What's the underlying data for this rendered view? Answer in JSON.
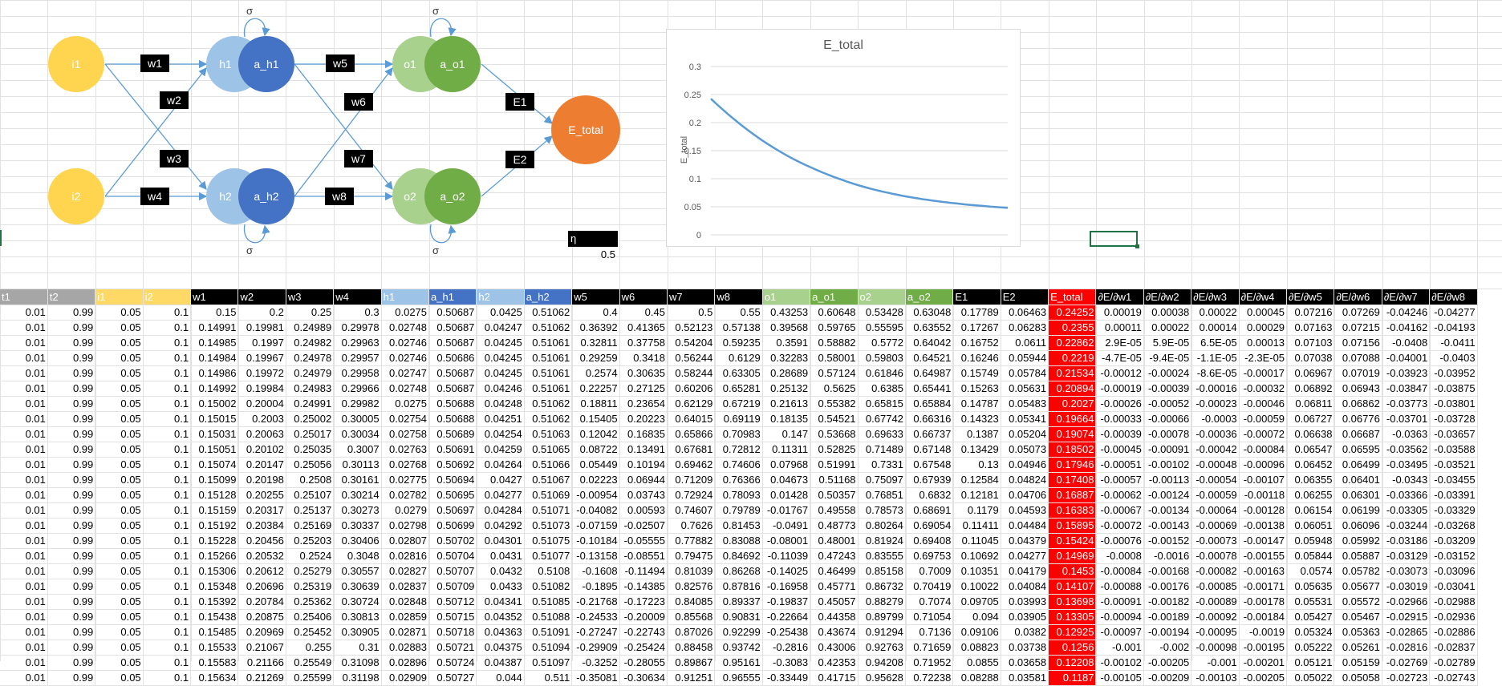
{
  "diagram": {
    "inputs": [
      "i1",
      "i2"
    ],
    "hidden_net": [
      "h1",
      "h2"
    ],
    "hidden_act": [
      "a_h1",
      "a_h2"
    ],
    "output_net": [
      "o1",
      "o2"
    ],
    "output_act": [
      "a_o1",
      "a_o2"
    ],
    "total": "E_total",
    "weights": [
      "w1",
      "w2",
      "w3",
      "w4",
      "w5",
      "w6",
      "w7",
      "w8"
    ],
    "errors": [
      "E1",
      "E2"
    ],
    "sigma": "σ"
  },
  "eta": {
    "label": "η",
    "value": "0.5"
  },
  "chart_data": {
    "type": "line",
    "title": "E_total",
    "ylabel": "E_total",
    "xlabel": "",
    "ylim": [
      0,
      0.3
    ],
    "yticks": [
      "0",
      "0.05",
      "0.1",
      "0.15",
      "0.2",
      "0.25",
      "0.3"
    ],
    "series": [
      {
        "values": [
          0.24252,
          0.2355,
          0.22862,
          0.2219,
          0.21534,
          0.20894,
          0.2027,
          0.19664,
          0.19074,
          0.18502,
          0.17946,
          0.17408,
          0.16887,
          0.16383,
          0.15895,
          0.15424,
          0.14969,
          0.1453,
          0.14107,
          0.13698,
          0.13305,
          0.12925,
          0.1256,
          0.12208,
          0.1187,
          0.1154,
          0.1122,
          0.1091,
          0.1061,
          0.1032,
          0.1004,
          0.0977,
          0.0951,
          0.0926,
          0.0902,
          0.0879,
          0.0857,
          0.0836,
          0.0816,
          0.0797,
          0.0779,
          0.0762,
          0.0745,
          0.0729,
          0.0714,
          0.0699,
          0.0685,
          0.0672,
          0.0659,
          0.0647,
          0.0635,
          0.0624,
          0.0613,
          0.0603,
          0.0593,
          0.0584,
          0.0575,
          0.0566,
          0.0558,
          0.055,
          0.0542,
          0.0535,
          0.0528,
          0.0521,
          0.0515,
          0.0508,
          0.0502,
          0.0497,
          0.0491,
          0.0486,
          0.048
        ]
      }
    ]
  },
  "table": {
    "headers": [
      "t1",
      "t2",
      "i1",
      "i2",
      "w1",
      "w2",
      "w3",
      "w4",
      "h1",
      "a_h1",
      "h2",
      "a_h2",
      "w5",
      "w6",
      "w7",
      "w8",
      "o1",
      "a_o1",
      "o2",
      "a_o2",
      "E1",
      "E2",
      "E_total",
      "∂E/∂w1",
      "∂E/∂w2",
      "∂E/∂w3",
      "∂E/∂w4",
      "∂E/∂w5",
      "∂E/∂w6",
      "∂E/∂w7",
      "∂E/∂w8"
    ],
    "header_colors": [
      "#a6a6a6",
      "#a6a6a6",
      "#ffd966",
      "#ffd966",
      "#000000",
      "#000000",
      "#000000",
      "#000000",
      "#9dc3e6",
      "#4472c4",
      "#9dc3e6",
      "#4472c4",
      "#000000",
      "#000000",
      "#000000",
      "#000000",
      "#a9d18e",
      "#70ad47",
      "#a9d18e",
      "#70ad47",
      "#000000",
      "#000000",
      "#ff0000",
      "#000000",
      "#000000",
      "#000000",
      "#000000",
      "#000000",
      "#000000",
      "#000000",
      "#000000"
    ],
    "rows": [
      [
        "0.01",
        "0.99",
        "0.05",
        "0.1",
        "0.15",
        "0.2",
        "0.25",
        "0.3",
        "0.0275",
        "0.50687",
        "0.0425",
        "0.51062",
        "0.4",
        "0.45",
        "0.5",
        "0.55",
        "0.43253",
        "0.60648",
        "0.53428",
        "0.63048",
        "0.17789",
        "0.06463",
        "0.24252",
        "0.00019",
        "0.00038",
        "0.00022",
        "0.00045",
        "0.07216",
        "0.07269",
        "-0.04246",
        "-0.04277"
      ],
      [
        "0.01",
        "0.99",
        "0.05",
        "0.1",
        "0.14991",
        "0.19981",
        "0.24989",
        "0.29978",
        "0.02748",
        "0.50687",
        "0.04247",
        "0.51062",
        "0.36392",
        "0.41365",
        "0.52123",
        "0.57138",
        "0.39568",
        "0.59765",
        "0.55595",
        "0.63552",
        "0.17267",
        "0.06283",
        "0.2355",
        "0.00011",
        "0.00022",
        "0.00014",
        "0.00029",
        "0.07163",
        "0.07215",
        "-0.04162",
        "-0.04193"
      ],
      [
        "0.01",
        "0.99",
        "0.05",
        "0.1",
        "0.14985",
        "0.1997",
        "0.24982",
        "0.29963",
        "0.02746",
        "0.50687",
        "0.04245",
        "0.51061",
        "0.32811",
        "0.37758",
        "0.54204",
        "0.59235",
        "0.3591",
        "0.58882",
        "0.5772",
        "0.64042",
        "0.16752",
        "0.0611",
        "0.22862",
        "2.9E-05",
        "5.9E-05",
        "6.5E-05",
        "0.00013",
        "0.07103",
        "0.07156",
        "-0.0408",
        "-0.0411"
      ],
      [
        "0.01",
        "0.99",
        "0.05",
        "0.1",
        "0.14984",
        "0.19967",
        "0.24978",
        "0.29957",
        "0.02746",
        "0.50686",
        "0.04245",
        "0.51061",
        "0.29259",
        "0.3418",
        "0.56244",
        "0.6129",
        "0.32283",
        "0.58001",
        "0.59803",
        "0.64521",
        "0.16246",
        "0.05944",
        "0.2219",
        "-4.7E-05",
        "-9.4E-05",
        "-1.1E-05",
        "-2.3E-05",
        "0.07038",
        "0.07088",
        "-0.04001",
        "-0.0403"
      ],
      [
        "0.01",
        "0.99",
        "0.05",
        "0.1",
        "0.14986",
        "0.19972",
        "0.24979",
        "0.29958",
        "0.02747",
        "0.50687",
        "0.04245",
        "0.51061",
        "0.2574",
        "0.30635",
        "0.58244",
        "0.63305",
        "0.28689",
        "0.57124",
        "0.61846",
        "0.64987",
        "0.15749",
        "0.05784",
        "0.21534",
        "-0.00012",
        "-0.00024",
        "-8.6E-05",
        "-0.00017",
        "0.06967",
        "0.07019",
        "-0.03923",
        "-0.03952"
      ],
      [
        "0.01",
        "0.99",
        "0.05",
        "0.1",
        "0.14992",
        "0.19984",
        "0.24983",
        "0.29966",
        "0.02748",
        "0.50687",
        "0.04246",
        "0.51061",
        "0.22257",
        "0.27125",
        "0.60206",
        "0.65281",
        "0.25132",
        "0.5625",
        "0.6385",
        "0.65441",
        "0.15263",
        "0.05631",
        "0.20894",
        "-0.00019",
        "-0.00039",
        "-0.00016",
        "-0.00032",
        "0.06892",
        "0.06943",
        "-0.03847",
        "-0.03875"
      ],
      [
        "0.01",
        "0.99",
        "0.05",
        "0.1",
        "0.15002",
        "0.20004",
        "0.24991",
        "0.29982",
        "0.0275",
        "0.50688",
        "0.04248",
        "0.51062",
        "0.18811",
        "0.23654",
        "0.62129",
        "0.67219",
        "0.21613",
        "0.55382",
        "0.65815",
        "0.65884",
        "0.14787",
        "0.05483",
        "0.2027",
        "-0.00026",
        "-0.00052",
        "-0.00023",
        "-0.00046",
        "0.06811",
        "0.06862",
        "-0.03773",
        "-0.03801"
      ],
      [
        "0.01",
        "0.99",
        "0.05",
        "0.1",
        "0.15015",
        "0.2003",
        "0.25002",
        "0.30005",
        "0.02754",
        "0.50688",
        "0.04251",
        "0.51062",
        "0.15405",
        "0.20223",
        "0.64015",
        "0.69119",
        "0.18135",
        "0.54521",
        "0.67742",
        "0.66316",
        "0.14323",
        "0.05341",
        "0.19664",
        "-0.00033",
        "-0.00066",
        "-0.0003",
        "-0.00059",
        "0.06727",
        "0.06776",
        "-0.03701",
        "-0.03728"
      ],
      [
        "0.01",
        "0.99",
        "0.05",
        "0.1",
        "0.15031",
        "0.20063",
        "0.25017",
        "0.30034",
        "0.02758",
        "0.50689",
        "0.04254",
        "0.51063",
        "0.12042",
        "0.16835",
        "0.65866",
        "0.70983",
        "0.147",
        "0.53668",
        "0.69633",
        "0.66737",
        "0.1387",
        "0.05204",
        "0.19074",
        "-0.00039",
        "-0.00078",
        "-0.00036",
        "-0.00072",
        "0.06638",
        "0.06687",
        "-0.0363",
        "-0.03657"
      ],
      [
        "0.01",
        "0.99",
        "0.05",
        "0.1",
        "0.15051",
        "0.20102",
        "0.25035",
        "0.3007",
        "0.02763",
        "0.50691",
        "0.04259",
        "0.51065",
        "0.08722",
        "0.13491",
        "0.67681",
        "0.72812",
        "0.11311",
        "0.52825",
        "0.71489",
        "0.67148",
        "0.13429",
        "0.05073",
        "0.18502",
        "-0.00045",
        "-0.00091",
        "-0.00042",
        "-0.00084",
        "0.06547",
        "0.06595",
        "-0.03562",
        "-0.03588"
      ],
      [
        "0.01",
        "0.99",
        "0.05",
        "0.1",
        "0.15074",
        "0.20147",
        "0.25056",
        "0.30113",
        "0.02768",
        "0.50692",
        "0.04264",
        "0.51066",
        "0.05449",
        "0.10194",
        "0.69462",
        "0.74606",
        "0.07968",
        "0.51991",
        "0.7331",
        "0.67548",
        "0.13",
        "0.04946",
        "0.17946",
        "-0.00051",
        "-0.00102",
        "-0.00048",
        "-0.00096",
        "0.06452",
        "0.06499",
        "-0.03495",
        "-0.03521"
      ],
      [
        "0.01",
        "0.99",
        "0.05",
        "0.1",
        "0.15099",
        "0.20198",
        "0.2508",
        "0.30161",
        "0.02775",
        "0.50694",
        "0.0427",
        "0.51067",
        "0.02223",
        "0.06944",
        "0.71209",
        "0.76366",
        "0.04673",
        "0.51168",
        "0.75097",
        "0.67939",
        "0.12584",
        "0.04824",
        "0.17408",
        "-0.00057",
        "-0.00113",
        "-0.00054",
        "-0.00107",
        "0.06355",
        "0.06401",
        "-0.0343",
        "-0.03455"
      ],
      [
        "0.01",
        "0.99",
        "0.05",
        "0.1",
        "0.15128",
        "0.20255",
        "0.25107",
        "0.30214",
        "0.02782",
        "0.50695",
        "0.04277",
        "0.51069",
        "-0.00954",
        "0.03743",
        "0.72924",
        "0.78093",
        "0.01428",
        "0.50357",
        "0.76851",
        "0.6832",
        "0.12181",
        "0.04706",
        "0.16887",
        "-0.00062",
        "-0.00124",
        "-0.00059",
        "-0.00118",
        "0.06255",
        "0.06301",
        "-0.03366",
        "-0.03391"
      ],
      [
        "0.01",
        "0.99",
        "0.05",
        "0.1",
        "0.15159",
        "0.20317",
        "0.25137",
        "0.30273",
        "0.0279",
        "0.50697",
        "0.04284",
        "0.51071",
        "-0.04082",
        "0.00593",
        "0.74607",
        "0.79789",
        "-0.01767",
        "0.49558",
        "0.78573",
        "0.68691",
        "0.1179",
        "0.04593",
        "0.16383",
        "-0.00067",
        "-0.00134",
        "-0.00064",
        "-0.00128",
        "0.06154",
        "0.06199",
        "-0.03305",
        "-0.03329"
      ],
      [
        "0.01",
        "0.99",
        "0.05",
        "0.1",
        "0.15192",
        "0.20384",
        "0.25169",
        "0.30337",
        "0.02798",
        "0.50699",
        "0.04292",
        "0.51073",
        "-0.07159",
        "-0.02507",
        "0.7626",
        "0.81453",
        "-0.0491",
        "0.48773",
        "0.80264",
        "0.69054",
        "0.11411",
        "0.04484",
        "0.15895",
        "-0.00072",
        "-0.00143",
        "-0.00069",
        "-0.00138",
        "0.06051",
        "0.06096",
        "-0.03244",
        "-0.03268"
      ],
      [
        "0.01",
        "0.99",
        "0.05",
        "0.1",
        "0.15228",
        "0.20456",
        "0.25203",
        "0.30406",
        "0.02807",
        "0.50702",
        "0.04301",
        "0.51075",
        "-0.10184",
        "-0.05555",
        "0.77882",
        "0.83088",
        "-0.08001",
        "0.48001",
        "0.81924",
        "0.69408",
        "0.11045",
        "0.04379",
        "0.15424",
        "-0.00076",
        "-0.00152",
        "-0.00073",
        "-0.00147",
        "0.05948",
        "0.05992",
        "-0.03186",
        "-0.03209"
      ],
      [
        "0.01",
        "0.99",
        "0.05",
        "0.1",
        "0.15266",
        "0.20532",
        "0.2524",
        "0.3048",
        "0.02816",
        "0.50704",
        "0.0431",
        "0.51077",
        "-0.13158",
        "-0.08551",
        "0.79475",
        "0.84692",
        "-0.11039",
        "0.47243",
        "0.83555",
        "0.69753",
        "0.10692",
        "0.04277",
        "0.14969",
        "-0.0008",
        "-0.0016",
        "-0.00078",
        "-0.00155",
        "0.05844",
        "0.05887",
        "-0.03129",
        "-0.03152"
      ],
      [
        "0.01",
        "0.99",
        "0.05",
        "0.1",
        "0.15306",
        "0.20612",
        "0.25279",
        "0.30557",
        "0.02827",
        "0.50707",
        "0.0432",
        "0.5108",
        "-0.1608",
        "-0.11494",
        "0.81039",
        "0.86268",
        "-0.14025",
        "0.46499",
        "0.85158",
        "0.7009",
        "0.10351",
        "0.04179",
        "0.1453",
        "-0.00084",
        "-0.00168",
        "-0.00082",
        "-0.00163",
        "0.0574",
        "0.05782",
        "-0.03073",
        "-0.03096"
      ],
      [
        "0.01",
        "0.99",
        "0.05",
        "0.1",
        "0.15348",
        "0.20696",
        "0.25319",
        "0.30639",
        "0.02837",
        "0.50709",
        "0.0433",
        "0.51082",
        "-0.1895",
        "-0.14385",
        "0.82576",
        "0.87816",
        "-0.16958",
        "0.45771",
        "0.86732",
        "0.70419",
        "0.10022",
        "0.04084",
        "0.14107",
        "-0.00088",
        "-0.00176",
        "-0.00085",
        "-0.00171",
        "0.05635",
        "0.05677",
        "-0.03019",
        "-0.03041"
      ],
      [
        "0.01",
        "0.99",
        "0.05",
        "0.1",
        "0.15392",
        "0.20784",
        "0.25362",
        "0.30724",
        "0.02848",
        "0.50712",
        "0.04341",
        "0.51085",
        "-0.21768",
        "-0.17223",
        "0.84085",
        "0.89337",
        "-0.19837",
        "0.45057",
        "0.88279",
        "0.7074",
        "0.09705",
        "0.03993",
        "0.13698",
        "-0.00091",
        "-0.00182",
        "-0.00089",
        "-0.00178",
        "0.05531",
        "0.05572",
        "-0.02966",
        "-0.02988"
      ],
      [
        "0.01",
        "0.99",
        "0.05",
        "0.1",
        "0.15438",
        "0.20875",
        "0.25406",
        "0.30813",
        "0.02859",
        "0.50715",
        "0.04352",
        "0.51088",
        "-0.24533",
        "-0.20009",
        "0.85568",
        "0.90831",
        "-0.22664",
        "0.44358",
        "0.89799",
        "0.71054",
        "0.094",
        "0.03905",
        "0.13305",
        "-0.00094",
        "-0.00189",
        "-0.00092",
        "-0.00184",
        "0.05427",
        "0.05467",
        "-0.02915",
        "-0.02936"
      ],
      [
        "0.01",
        "0.99",
        "0.05",
        "0.1",
        "0.15485",
        "0.20969",
        "0.25452",
        "0.30905",
        "0.02871",
        "0.50718",
        "0.04363",
        "0.51091",
        "-0.27247",
        "-0.22743",
        "0.87026",
        "0.92299",
        "-0.25438",
        "0.43674",
        "0.91294",
        "0.7136",
        "0.09106",
        "0.0382",
        "0.12925",
        "-0.00097",
        "-0.00194",
        "-0.00095",
        "-0.0019",
        "0.05324",
        "0.05363",
        "-0.02865",
        "-0.02886"
      ],
      [
        "0.01",
        "0.99",
        "0.05",
        "0.1",
        "0.15533",
        "0.21067",
        "0.255",
        "0.31",
        "0.02883",
        "0.50721",
        "0.04375",
        "0.51094",
        "-0.29909",
        "-0.25424",
        "0.88458",
        "0.93742",
        "-0.2816",
        "0.43006",
        "0.92763",
        "0.71659",
        "0.08823",
        "0.03738",
        "0.1256",
        "-0.001",
        "-0.002",
        "-0.00098",
        "-0.00195",
        "0.05222",
        "0.05261",
        "-0.02816",
        "-0.02837"
      ],
      [
        "0.01",
        "0.99",
        "0.05",
        "0.1",
        "0.15583",
        "0.21166",
        "0.25549",
        "0.31098",
        "0.02896",
        "0.50724",
        "0.04387",
        "0.51097",
        "-0.3252",
        "-0.28055",
        "0.89867",
        "0.95161",
        "-0.3083",
        "0.42353",
        "0.94208",
        "0.71952",
        "0.0855",
        "0.03658",
        "0.12208",
        "-0.00102",
        "-0.00205",
        "-0.001",
        "-0.00201",
        "0.05121",
        "0.05159",
        "-0.02769",
        "-0.02789"
      ],
      [
        "0.01",
        "0.99",
        "0.05",
        "0.1",
        "0.15634",
        "0.21269",
        "0.25599",
        "0.31198",
        "0.02909",
        "0.50727",
        "0.044",
        "0.511",
        "-0.35081",
        "-0.30634",
        "0.91251",
        "0.96555",
        "-0.33449",
        "0.41715",
        "0.95628",
        "0.72238",
        "0.08288",
        "0.03581",
        "0.1187",
        "-0.00105",
        "-0.00209",
        "-0.00103",
        "-0.00205",
        "0.05022",
        "0.05058",
        "-0.02723",
        "-0.02743"
      ]
    ]
  }
}
